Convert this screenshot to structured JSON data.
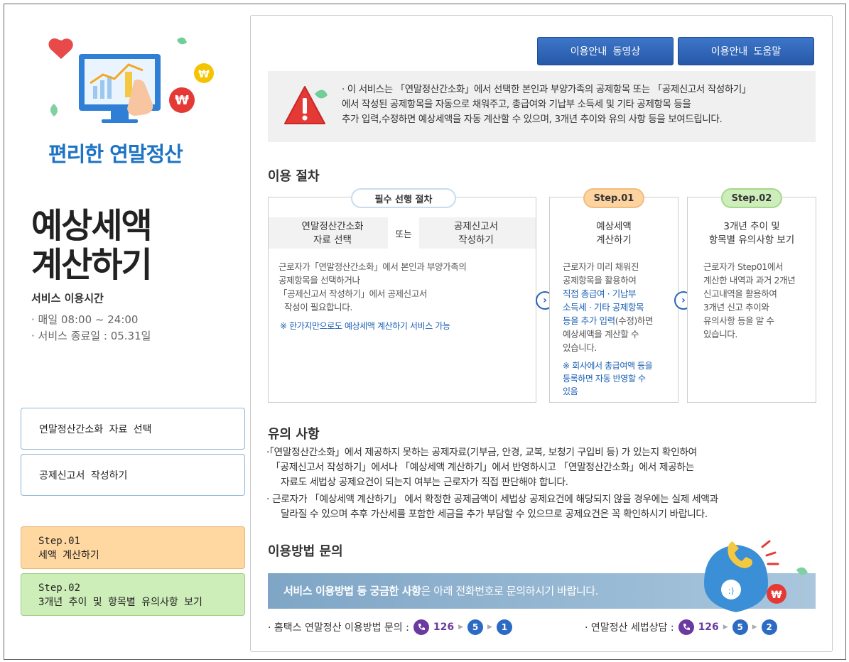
{
  "left": {
    "hero_title": "편리한 연말정산",
    "title_line1": "예상세액",
    "title_line2": "계산하기",
    "service_time_label": "서비스 이용시간",
    "service_hours": "· 매일 08:00  ~ 24:00",
    "service_end": "· 서비스 종료일 : 05.31일",
    "menu": [
      {
        "label": "연말정산간소화 자료 선택"
      },
      {
        "label": "공제신고서 작성하기"
      }
    ],
    "step1": {
      "label": "Step.01",
      "desc": "세액 계산하기",
      "color": "#ffd7a0"
    },
    "step2": {
      "label": "Step.02",
      "desc": "3개년 추이 및 항목별 유의사항 보기",
      "color": "#cdedb9"
    }
  },
  "top_buttons": {
    "video": "이용안내 동영상",
    "help": "이용안내 도움말"
  },
  "notice": {
    "line1": "· 이 서비스는 「연말정산간소화」에서 선택한 본인과 부양가족의 공제항목 또는  「공제신고서 작성하기」",
    "line2": "에서 작성된 공제항목을 자동으로 채워주고, 총급여와 기납부 소득세 및 기타 공제항목 등을",
    "line3": "추가 입력,수정하면 예상세액을 자동 계산할 수 있으며, 3개년 추이와 유의 사항 등을 보여드립니다."
  },
  "procedure": {
    "title": "이용 절차",
    "required": {
      "pill": "필수 선행 절차",
      "opt_a_line1": "연말정산간소화",
      "opt_a_line2": "자료 선택",
      "or": "또는",
      "opt_b_line1": "공제신고서",
      "opt_b_line2": "작성하기",
      "body1": "근로자가「연말정산간소화」에서 본인과 부양가족의",
      "body2": "공제항목을 선택하거나",
      "body3": "「공제신고서 작성하기」에서 공제신고서",
      "body4": "작성이 필요합니다.",
      "note": "※ 한가지만으로도 예상세액 계산하기 서비스 가능"
    },
    "step1": {
      "pill": "Step.01",
      "pill_color": "#fdd3a0",
      "head1": "예상세액",
      "head2": "계산하기",
      "body1": "근로자가 미리 채워진",
      "body2": "공제항목을 활용하여",
      "body3a": "직접 총급여 · 기납부",
      "body4a": "소득세 · 기타 공제항목",
      "body5a": "등을 추가 입력",
      "body5b": "(수정)하면",
      "body6": "예상세액을 계산할 수",
      "body7": "있습니다.",
      "note1": "※ 회사에서 총급여액 등을",
      "note2": "등록하면 자동 반영할 수",
      "note3": "있음"
    },
    "step2": {
      "pill": "Step.02",
      "pill_color": "#cdeebb",
      "head1": "3개년 추이 및",
      "head2": "항목별 유의사항 보기",
      "body1": "근로자가 Step01에서",
      "body2": "계산한 내역과 과거 2개년",
      "body3": "신고내역을 활용하여",
      "body4": "3개년 신고 추이와",
      "body5": "유의사항 등을 알 수",
      "body6": "있습니다."
    }
  },
  "caution": {
    "title": "유의 사항",
    "p1_l1": "·「연말정산간소화」에서 제공하지 못하는 공제자료(기부금, 안경, 교복, 보청기 구입비 등) 가 있는지 확인하여",
    "p1_l2": "「공제신고서 작성하기」에서나 「예상세액 계산하기」에서 반영하시고  「연말정산간소화」에서 제공하는",
    "p1_l3": "자료도 세법상 공제요건이 되는지 여부는 근로자가 직접 판단해야 합니다.",
    "p2_l1": "· 근로자가 「예상세액 계산하기」 에서 확정한 공제금액이 세법상 공제요건에 해당되지 않을 경우에는 실제 세액과",
    "p2_l2": "달라질 수 있으며 추후 가산세를 포함한 세금을 추가 부담할 수 있으므로 공제요건은 꼭 확인하시기 바랍니다."
  },
  "inquiry": {
    "title": "이용방법 문의",
    "banner_bold": "서비스 이용방법 등 궁금한 사항",
    "banner_rest": "은 아래 전화번호로 문의하시기 바랍니다.",
    "contact1_label": "· 홈택스 연말정산 이용방법 문의  :",
    "contact1_num": "126",
    "contact1_d1": "5",
    "contact1_d2": "1",
    "contact2_label": "· 연말정산 세법상담  :",
    "contact2_num": "126",
    "contact2_d1": "5",
    "contact2_d2": "2"
  }
}
